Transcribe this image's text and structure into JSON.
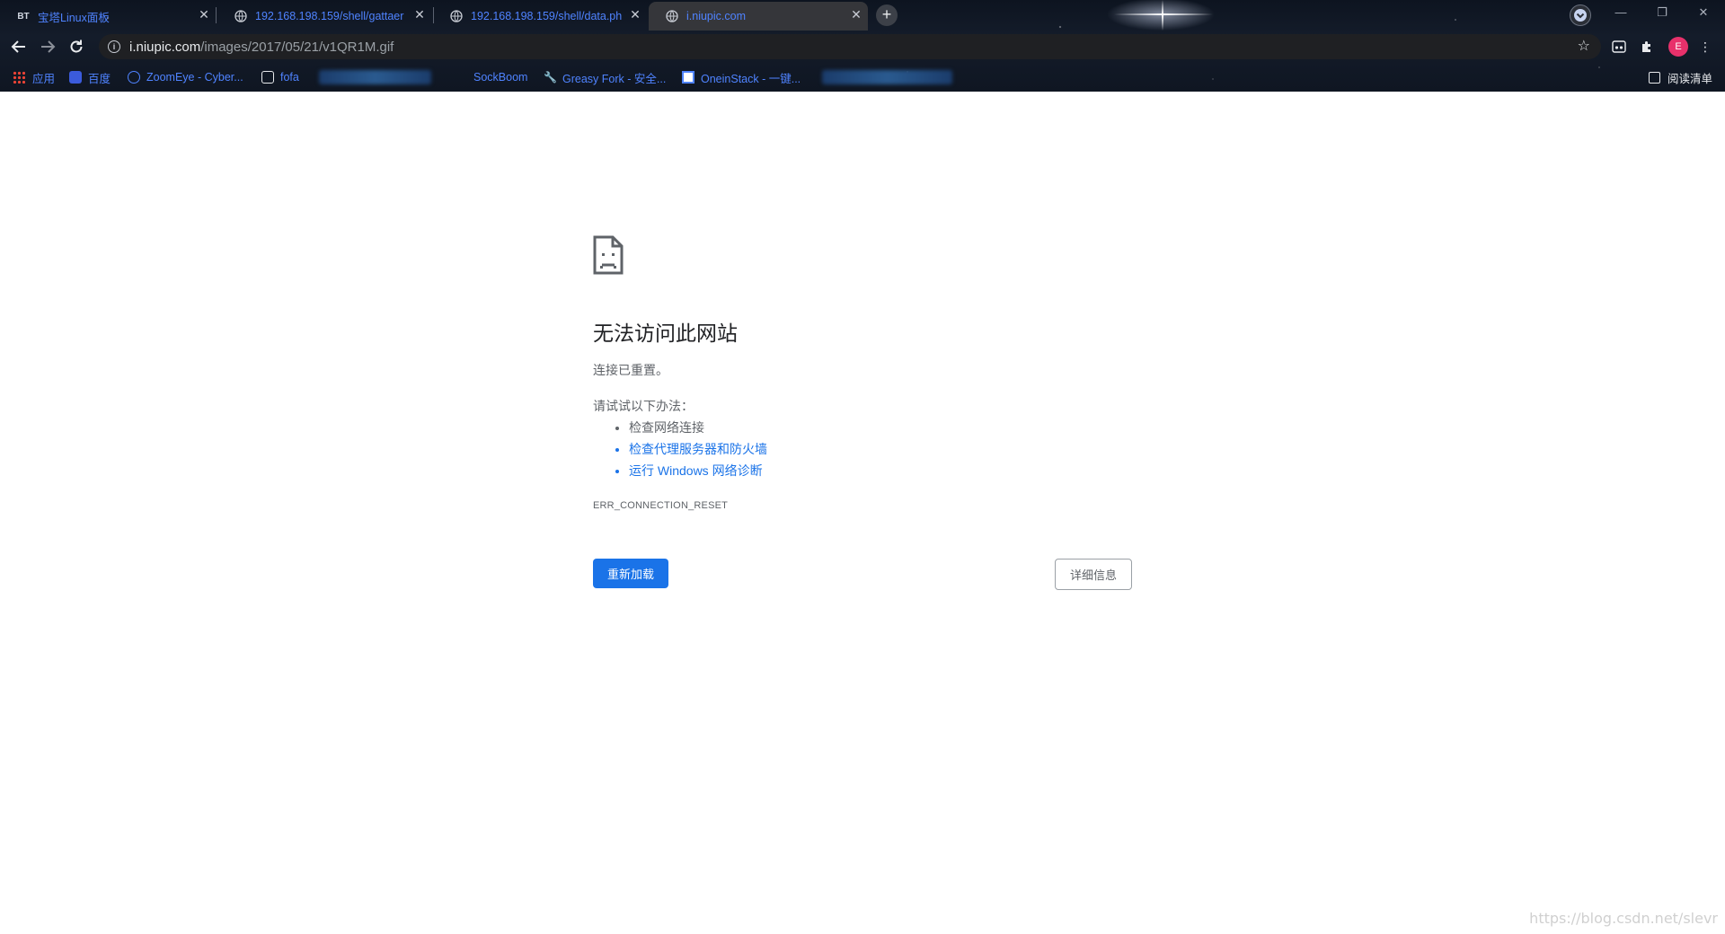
{
  "tabs": [
    {
      "favicon": "BT",
      "title": "宝塔Linux面板",
      "active": false
    },
    {
      "favicon": "globe-icon",
      "title": "192.168.198.159/shell/gattaer",
      "active": false
    },
    {
      "favicon": "globe-icon",
      "title": "192.168.198.159/shell/data.ph",
      "active": false
    },
    {
      "favicon": "globe-icon",
      "title": "i.niupic.com",
      "active": true
    }
  ],
  "toolbar": {
    "url_host": "i.niupic.com",
    "url_path": "/images/2017/05/21/v1QR1M.gif",
    "avatar_letter": "E"
  },
  "bookmarks": [
    {
      "label": "应用",
      "icon": "apps-icon"
    },
    {
      "label": "百度",
      "icon": "baidu-icon"
    },
    {
      "label": "ZoomEye - Cyber...",
      "icon": "zoomeye-icon"
    },
    {
      "label": "fofa",
      "icon": "fofa-icon"
    },
    {
      "label": "SockBoom",
      "icon": ""
    },
    {
      "label": "Greasy Fork - 安全...",
      "icon": "greasyfork-icon"
    },
    {
      "label": "OneinStack - 一键...",
      "icon": "oneinstack-icon"
    }
  ],
  "reading_list": "阅读清单",
  "error": {
    "title": "无法访问此网站",
    "subtitle": "连接已重置。",
    "try_label": "请试试以下办法：",
    "suggestions": [
      {
        "text": "检查网络连接",
        "link": false
      },
      {
        "text": "检查代理服务器和防火墙",
        "link": true
      },
      {
        "text": "运行 Windows 网络诊断",
        "link": true
      }
    ],
    "code": "ERR_CONNECTION_RESET",
    "reload_button": "重新加载",
    "details_button": "详细信息"
  },
  "watermark": "https://blog.csdn.net/slevr",
  "colors": {
    "accent": "#1a73e8",
    "tab_text": "#4f83ff",
    "avatar": "#e8316b"
  }
}
